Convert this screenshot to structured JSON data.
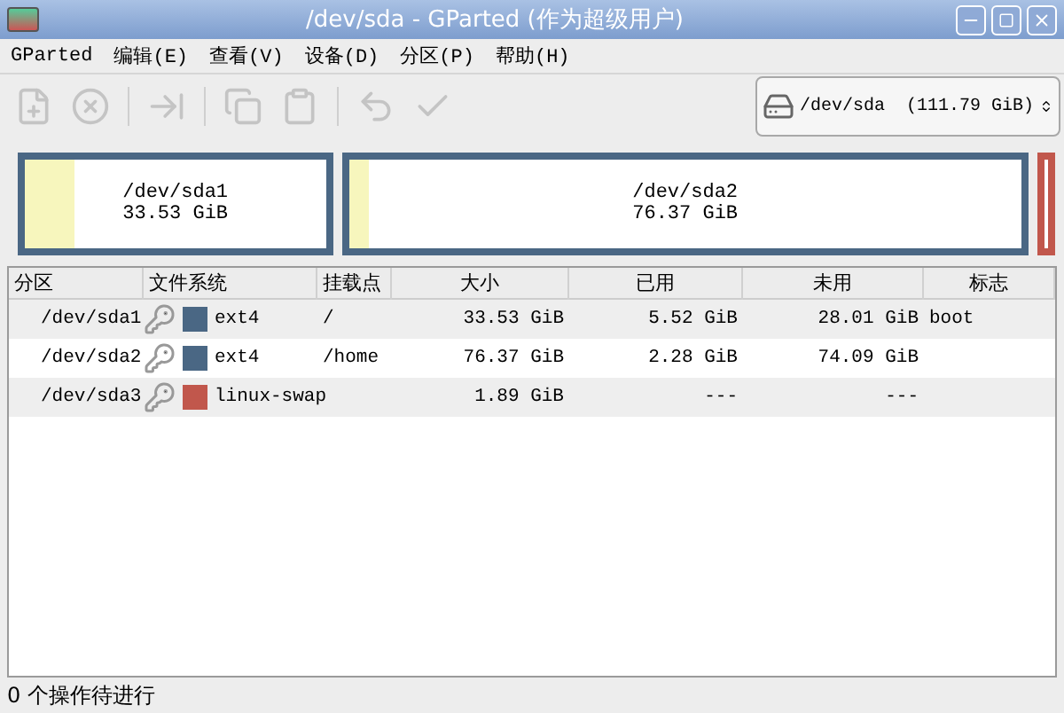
{
  "window": {
    "title": "/dev/sda - GParted (作为超级用户)"
  },
  "menu": [
    {
      "label": "GParted"
    },
    {
      "label": "编辑(E)"
    },
    {
      "label": "查看(V)"
    },
    {
      "label": "设备(D)"
    },
    {
      "label": "分区(P)"
    },
    {
      "label": "帮助(H)"
    }
  ],
  "toolbar": [
    {
      "kind": "new",
      "disabled": true
    },
    {
      "kind": "delete",
      "disabled": true
    },
    {
      "kind": "sep"
    },
    {
      "kind": "resize",
      "disabled": true
    },
    {
      "kind": "sep"
    },
    {
      "kind": "copy",
      "disabled": true
    },
    {
      "kind": "paste",
      "disabled": true
    },
    {
      "kind": "sep"
    },
    {
      "kind": "undo",
      "disabled": true
    },
    {
      "kind": "apply",
      "disabled": true
    }
  ],
  "device": {
    "path": "/dev/sda",
    "size": "(111.79 GiB)"
  },
  "disk_map": [
    {
      "name": "/dev/sda1",
      "size": "33.53 GiB",
      "color": "#4a6784",
      "level": 0.165
    },
    {
      "name": "/dev/sda2",
      "size": "76.37 GiB",
      "color": "#4a6784",
      "level": 0.03
    },
    {
      "color": "#c1574c"
    }
  ],
  "table": {
    "columns": [
      "分区",
      "文件系统",
      "挂载点",
      "大小",
      "已用",
      "未用",
      "标志"
    ],
    "rows": [
      {
        "partition": "/dev/sda1",
        "locked": true,
        "fs": "ext4",
        "color": "#4a6784",
        "mount": "/",
        "size": "33.53 GiB",
        "used": "5.52 GiB",
        "unused": "28.01 GiB",
        "flags": "boot"
      },
      {
        "partition": "/dev/sda2",
        "locked": true,
        "fs": "ext4",
        "color": "#4a6784",
        "mount": "/home",
        "size": "76.37 GiB",
        "used": "2.28 GiB",
        "unused": "74.09 GiB"
      },
      {
        "partition": "/dev/sda3",
        "locked": true,
        "fs": "linux-swap",
        "color": "#c1574c",
        "size": "1.89 GiB",
        "used": "---",
        "unused": "---"
      }
    ]
  },
  "status_bar": "0 个操作待进行"
}
